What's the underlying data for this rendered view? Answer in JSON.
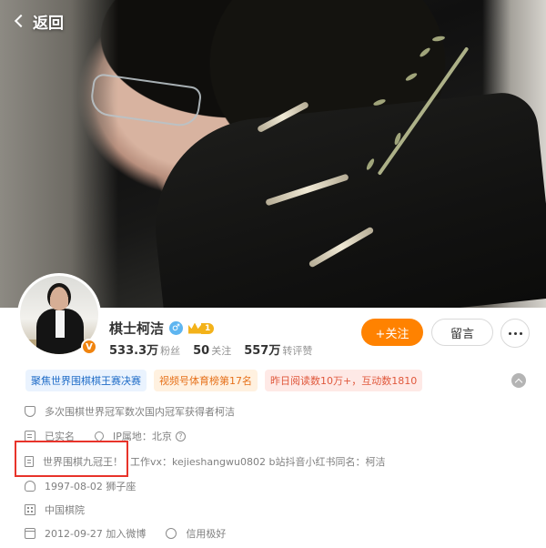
{
  "nav": {
    "back_label": "返回"
  },
  "profile": {
    "name": "棋士柯洁",
    "gender_symbol": "♂",
    "vip_level": "1",
    "verified_symbol": "V",
    "stats": [
      {
        "value": "533.3万",
        "label": "粉丝"
      },
      {
        "value": "50",
        "label": "关注"
      },
      {
        "value": "557万",
        "label": "转评赞"
      }
    ]
  },
  "actions": {
    "follow_label": "+关注",
    "message_label": "留言"
  },
  "tags": [
    {
      "text": "聚焦世界围棋棋王赛决赛",
      "style": "blue"
    },
    {
      "text": "视频号体育榜第17名",
      "style": "orange"
    },
    {
      "text": "昨日阅读数10万+，互动数1810",
      "style": "red"
    }
  ],
  "info": {
    "verification": "多次围棋世界冠军数次国内冠军获得者柯洁",
    "real_name": "已实名",
    "ip_location": "IP属地：北京",
    "bio_highlight": "世界围棋九冠王！",
    "bio_rest": "工作vx：kejieshangwu0802 b站抖音小红书同名：柯洁",
    "birthday": "1997-08-02 狮子座",
    "organization": "中国棋院",
    "joined": "2012-09-27 加入微博",
    "credit": "信用极好"
  },
  "colors": {
    "accent": "#ff8200",
    "highlight_box": "#e8332a",
    "tag_blue": "#1d6bc7",
    "tag_orange": "#e6711a",
    "tag_red": "#e0583c"
  }
}
